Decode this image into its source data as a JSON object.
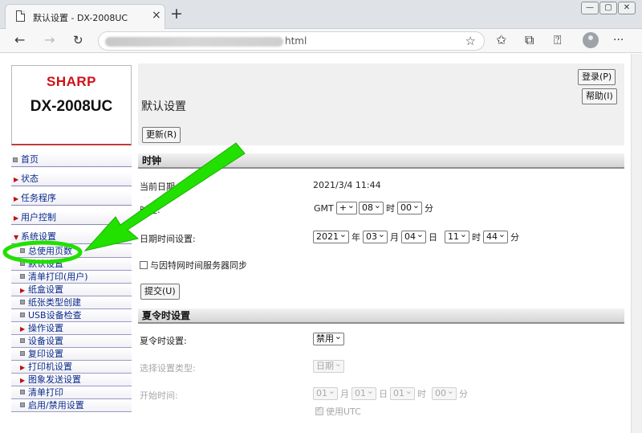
{
  "browser": {
    "tab_title": "默认设置 - DX-2008UC",
    "tab_close": "×",
    "new_tab": "+",
    "window_buttons": [
      "—",
      "▢",
      "✕"
    ],
    "address_suffix": "html",
    "toolbar_icons": [
      "back-icon",
      "forward-icon",
      "refresh-icon",
      "favorites-icon",
      "collections-icon",
      "share-icon",
      "profile-icon",
      "more-icon"
    ],
    "more": "···"
  },
  "logo": {
    "brand": "SHARP",
    "model": "DX-2008UC"
  },
  "nav": {
    "items": [
      {
        "label": "首页",
        "marker": "square"
      },
      {
        "label": "状态",
        "marker": "arrow"
      },
      {
        "label": "任务程序",
        "marker": "arrow"
      },
      {
        "label": "用户控制",
        "marker": "arrow"
      },
      {
        "label": "系统设置",
        "marker": "down"
      }
    ],
    "sub_items": [
      {
        "label": "总使用页数",
        "marker": "square"
      },
      {
        "label": "默认设置",
        "marker": "square"
      },
      {
        "label": "清单打印(用户)",
        "marker": "square"
      },
      {
        "label": "纸盒设置",
        "marker": "arrow"
      },
      {
        "label": "纸张类型创建",
        "marker": "square"
      },
      {
        "label": "USB设备检查",
        "marker": "square"
      },
      {
        "label": "操作设置",
        "marker": "arrow"
      },
      {
        "label": "设备设置",
        "marker": "square"
      },
      {
        "label": "复印设置",
        "marker": "square"
      },
      {
        "label": "打印机设置",
        "marker": "arrow"
      },
      {
        "label": "图象发送设置",
        "marker": "arrow"
      },
      {
        "label": "清单打印",
        "marker": "square"
      },
      {
        "label": "启用/禁用设置",
        "marker": "square"
      }
    ]
  },
  "content": {
    "login_button": "登录(P)",
    "help_button": "帮助(I)",
    "page_title": "默认设置",
    "update_button": "更新(R)",
    "clock": {
      "section_title": "时钟",
      "current_date_label": "当前日期:",
      "current_date_value": "2021/3/4 11:44",
      "timezone_label": "时区:",
      "gmt": "GMT",
      "sign": "+",
      "tz_hour": "08",
      "tz_hour_unit": "时",
      "tz_min": "00",
      "tz_min_unit": "分",
      "datetime_label": "日期时间设置:",
      "year": "2021",
      "year_unit": "年",
      "month": "03",
      "month_unit": "月",
      "day": "04",
      "day_unit": "日",
      "hour": "11",
      "hour_unit": "时",
      "minute": "44",
      "minute_unit": "分",
      "sync_label": "与因特网时间服务器同步",
      "submit_button": "提交(U)"
    },
    "dst": {
      "section_title": "夏令时设置",
      "dst_label": "夏令时设置:",
      "dst_value": "禁用",
      "type_label": "选择设置类型:",
      "type_value": "日期",
      "start_label": "开始时间:",
      "start_month": "01",
      "start_month_unit": "月",
      "start_day": "01",
      "start_day_unit": "日",
      "start_hour": "01",
      "start_hour_unit": "时",
      "start_min": "00",
      "start_min_unit": "分",
      "utc_label": "使用UTC"
    }
  },
  "annotation": {
    "arrow_color": "#22e000",
    "highlight_color": "#22e000"
  }
}
